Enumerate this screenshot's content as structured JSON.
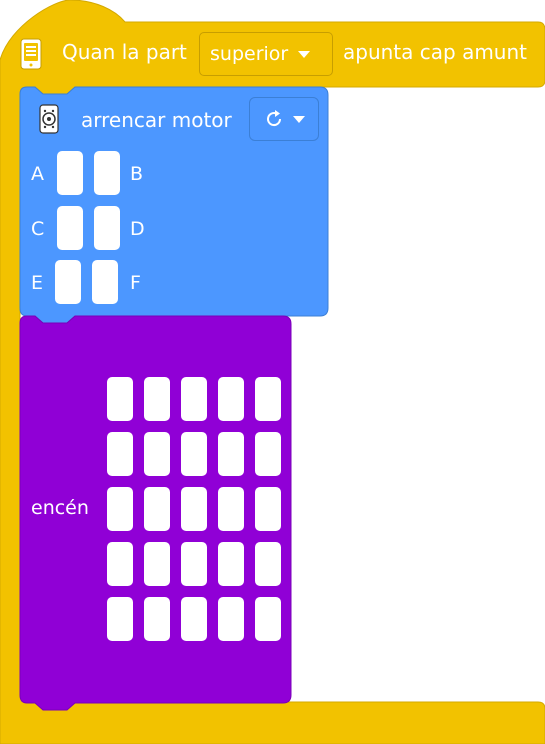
{
  "hat": {
    "label_before": "Quan la part",
    "orientation": "superior",
    "label_after": "apunta cap amunt",
    "icon": "microbit-device-icon",
    "color": "#f2c200"
  },
  "motor": {
    "label": "arrencar motor",
    "icon": "motor-icon",
    "direction_icon": "rotate-clockwise-icon",
    "color": "#4c97ff",
    "ports": {
      "a": "A",
      "b": "B",
      "c": "C",
      "d": "D",
      "e": "E",
      "f": "F"
    }
  },
  "display": {
    "label": "encén",
    "color": "#9000d6",
    "grid": "5x5"
  }
}
